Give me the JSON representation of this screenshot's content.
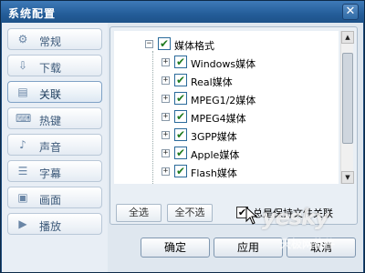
{
  "window": {
    "title": "系统配置",
    "close_label": "✕"
  },
  "sidebar": {
    "items": [
      {
        "label": "常规",
        "icon": "gear-icon",
        "glyph": "⚙"
      },
      {
        "label": "下载",
        "icon": "download-icon",
        "glyph": "⇩"
      },
      {
        "label": "关联",
        "icon": "association-icon",
        "glyph": "▤"
      },
      {
        "label": "热键",
        "icon": "hotkey-icon",
        "glyph": "⌨"
      },
      {
        "label": "声音",
        "icon": "speaker-icon",
        "glyph": "♪"
      },
      {
        "label": "字幕",
        "icon": "subtitle-icon",
        "glyph": "☰"
      },
      {
        "label": "画面",
        "icon": "picture-icon",
        "glyph": "▣"
      },
      {
        "label": "播放",
        "icon": "play-icon",
        "glyph": "▶"
      }
    ],
    "active_index": 2
  },
  "tree": {
    "root": {
      "label": "媒体格式",
      "expander": "−",
      "checked": "✔"
    },
    "children": [
      {
        "label": "Windows媒体",
        "expander": "+",
        "checked": "✔"
      },
      {
        "label": "Real媒体",
        "expander": "+",
        "checked": "✔"
      },
      {
        "label": "MPEG1/2媒体",
        "expander": "+",
        "checked": "✔"
      },
      {
        "label": "MPEG4媒体",
        "expander": "+",
        "checked": "✔"
      },
      {
        "label": "3GPP媒体",
        "expander": "+",
        "checked": "✔"
      },
      {
        "label": "Apple媒体",
        "expander": "+",
        "checked": "✔"
      },
      {
        "label": "Flash媒体",
        "expander": "+",
        "checked": "✔"
      }
    ],
    "scroll_up": "▲",
    "scroll_down": "▼"
  },
  "buttons": {
    "select_all": "全选",
    "select_none": "全不选",
    "always_keep_association": "总是保持文件关联",
    "always_keep_checked": "✔",
    "ok": "确定",
    "apply": "应用",
    "cancel": "取消"
  },
  "watermark": {
    "main": "yesky",
    "sub": "天极网软件"
  }
}
